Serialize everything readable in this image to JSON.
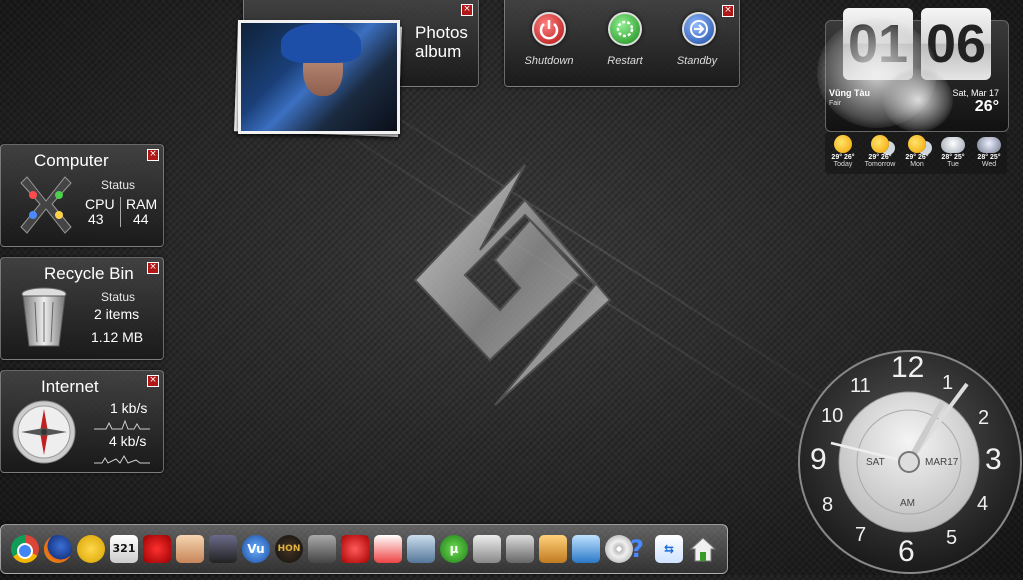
{
  "photos_gadget": {
    "label_line1": "Photos",
    "label_line2": "album"
  },
  "power_gadget": {
    "shutdown_label": "Shutdown",
    "restart_label": "Restart",
    "standby_label": "Standby"
  },
  "computer_gadget": {
    "title": "Computer",
    "status_label": "Status",
    "cpu_label": "CPU",
    "cpu_value": "43",
    "ram_label": "RAM",
    "ram_value": "44"
  },
  "recycle_gadget": {
    "title": "Recycle Bin",
    "status_label": "Status",
    "items": "2 items",
    "size": "1.12 MB"
  },
  "internet_gadget": {
    "title": "Internet",
    "upload": "1 kb/s",
    "download": "4 kb/s"
  },
  "weather_gadget": {
    "hour": "01",
    "minute": "06",
    "location": "Vũng Tàu",
    "condition": "Fair",
    "date": "Sat, Mar 17",
    "temperature": "26°",
    "forecast": [
      {
        "day": "Today",
        "high": "29°",
        "low": "26°",
        "icon": "sun-icon"
      },
      {
        "day": "Tomorrow",
        "high": "29°",
        "low": "26°",
        "icon": "partly-cloudy-icon"
      },
      {
        "day": "Mon",
        "high": "29°",
        "low": "26°",
        "icon": "partly-cloudy-icon"
      },
      {
        "day": "Tue",
        "high": "28°",
        "low": "25°",
        "icon": "cloudy-icon"
      },
      {
        "day": "Wed",
        "high": "28°",
        "low": "25°",
        "icon": "rain-icon"
      }
    ]
  },
  "analog_clock": {
    "numbers": [
      "12",
      "1",
      "2",
      "3",
      "4",
      "5",
      "6",
      "7",
      "8",
      "9",
      "10",
      "11"
    ],
    "day": "SAT",
    "date": "MAR17",
    "ampm": "AM"
  },
  "dock": {
    "icons": [
      "chrome-icon",
      "firefox-icon",
      "yahoo-messenger-icon",
      "media-player-321-icon",
      "garena-icon",
      "game-character-icon",
      "warcraft-icon",
      "vu-icon",
      "hon-icon",
      "game-icon",
      "game-icon-2",
      "game-icon-3",
      "settings-icon",
      "utorrent-icon",
      "camera-icon",
      "film-icon",
      "video-editor-icon",
      "network-icon",
      "dvd-icon",
      "help-icon",
      "teamviewer-icon",
      "home-icon"
    ],
    "labels": {
      "vu": "Vu",
      "hon": "HON",
      "num": "321",
      "help": "?"
    }
  },
  "colors": {
    "shutdown": "#c8202a",
    "restart": "#2aa02a",
    "standby": "#2060c0",
    "close": "#b01818"
  }
}
